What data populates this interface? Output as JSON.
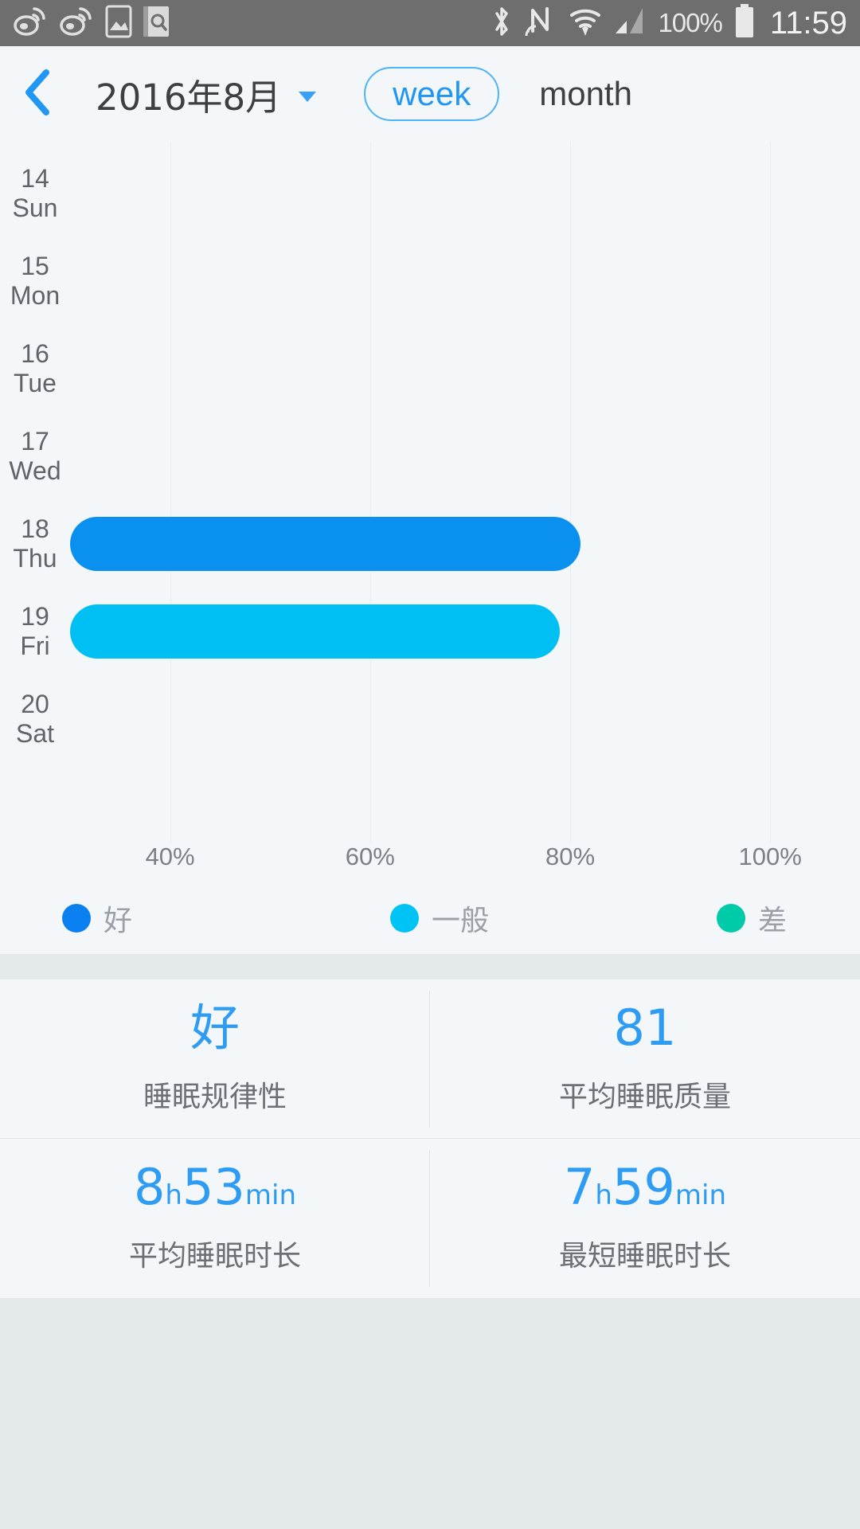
{
  "status_bar": {
    "background": "#6E6E6E",
    "left_icons": [
      "weibo-icon",
      "weibo-icon",
      "screenshot-icon",
      "notebook-search-icon"
    ],
    "right_icons": [
      "bluetooth-icon",
      "nfc-icon",
      "wifi-icon",
      "signal-icon"
    ],
    "battery_percent": "100%",
    "battery_icon": "battery-full-icon",
    "clock": "11:59"
  },
  "header": {
    "back_icon": "chevron-left-icon",
    "title": "2016年8月",
    "dropdown_icon": "caret-down-icon",
    "segment_week": "week",
    "segment_month": "month",
    "active_segment": "week",
    "accent": "#2196F3"
  },
  "chart_data": {
    "type": "bar",
    "orientation": "horizontal",
    "title": "",
    "xlabel": "",
    "ylabel": "",
    "xlim": [
      30,
      105
    ],
    "grid": true,
    "x_ticks": [
      "40%",
      "60%",
      "80%",
      "100%"
    ],
    "x_tick_values": [
      40,
      60,
      80,
      100
    ],
    "categories": [
      {
        "day_num": "14",
        "day_name": "Sun"
      },
      {
        "day_num": "15",
        "day_name": "Mon"
      },
      {
        "day_num": "16",
        "day_name": "Tue"
      },
      {
        "day_num": "17",
        "day_name": "Wed"
      },
      {
        "day_num": "18",
        "day_name": "Thu"
      },
      {
        "day_num": "19",
        "day_name": "Fri"
      },
      {
        "day_num": "20",
        "day_name": "Sat"
      }
    ],
    "values": [
      null,
      null,
      null,
      null,
      81,
      79,
      null
    ],
    "bar_quality": [
      null,
      null,
      null,
      null,
      "好",
      "一般",
      null
    ],
    "bar_colors": [
      null,
      null,
      null,
      null,
      "#0A91F0",
      "#00C0F3",
      null
    ],
    "legend": {
      "position": "bottom",
      "entries": [
        {
          "label": "好",
          "color": "#0A80F0"
        },
        {
          "label": "一般",
          "color": "#00C3F5"
        },
        {
          "label": "差",
          "color": "#00CBA8"
        }
      ]
    }
  },
  "stats": {
    "cells": [
      {
        "value": "好",
        "unit1": "",
        "value2": "",
        "unit2": "",
        "label": "睡眠规律性"
      },
      {
        "value": "81",
        "unit1": "",
        "value2": "",
        "unit2": "",
        "label": "平均睡眠质量"
      },
      {
        "value": "8",
        "unit1": "h",
        "value2": "53",
        "unit2": "min",
        "label": "平均睡眠时长"
      },
      {
        "value": "7",
        "unit1": "h",
        "value2": "59",
        "unit2": "min",
        "label": "最短睡眠时长"
      }
    ],
    "value_color": "#2F9CF4"
  }
}
